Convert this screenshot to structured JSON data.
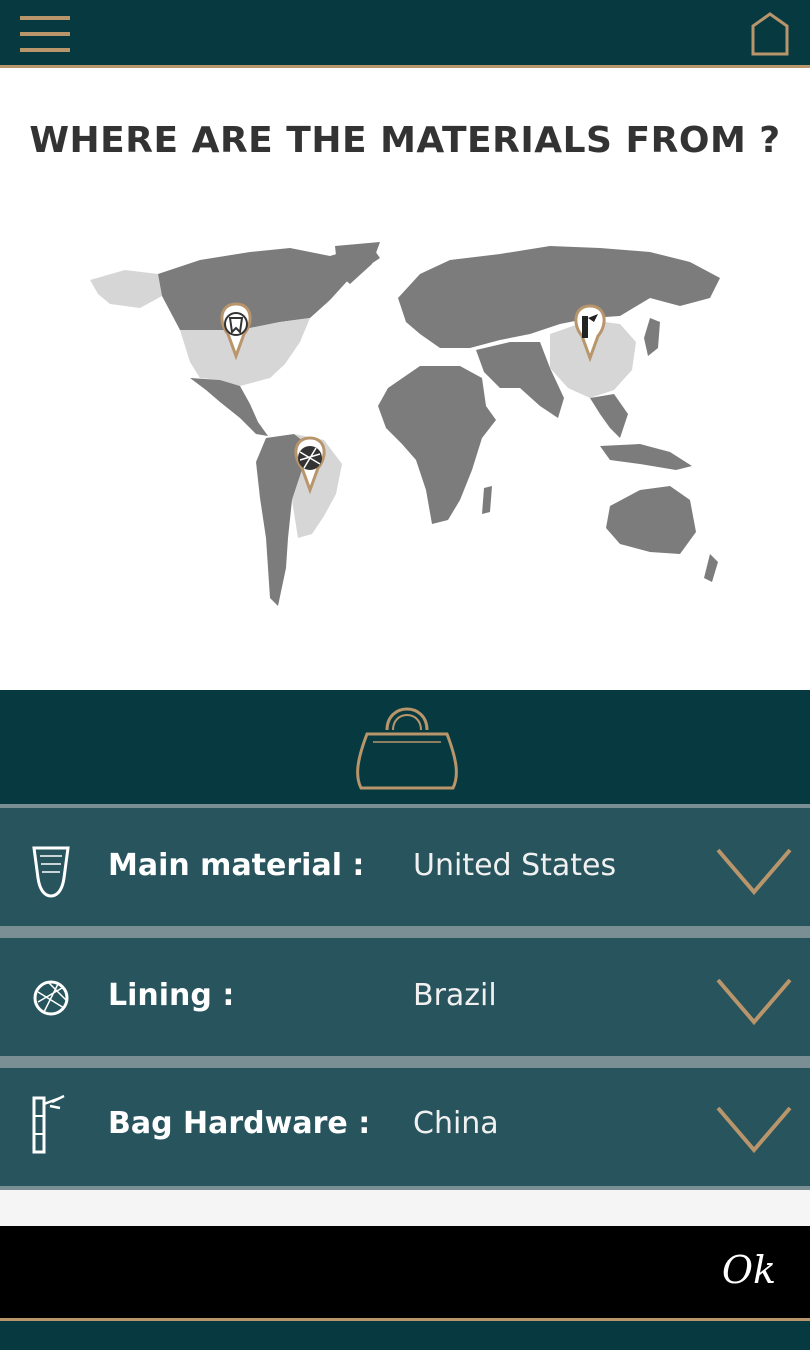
{
  "header": {
    "menu_icon": "hamburger-menu-icon",
    "home_icon": "home-icon"
  },
  "title": "WHERE ARE THE MATERIALS FROM ?",
  "map": {
    "highlight_color": "#d6d6d6",
    "land_color": "#7c7c7c",
    "pins": [
      {
        "region": "United States",
        "icon": "tooth-icon"
      },
      {
        "region": "Brazil",
        "icon": "yarn-ball-icon"
      },
      {
        "region": "China",
        "icon": "hardware-icon"
      }
    ]
  },
  "bag_icon": "handbag-icon",
  "materials": [
    {
      "label": "Main material :",
      "value": "United States",
      "icon": "tooth-icon"
    },
    {
      "label": "Lining :",
      "value": "Brazil",
      "icon": "yarn-ball-icon"
    },
    {
      "label": "Bag Hardware :",
      "value": "China",
      "icon": "hardware-icon"
    }
  ],
  "ok_label": "Ok",
  "colors": {
    "primary": "#073a40",
    "row": "#27545d",
    "accent_gold": "#b8956a",
    "ok_bar": "#000000"
  }
}
